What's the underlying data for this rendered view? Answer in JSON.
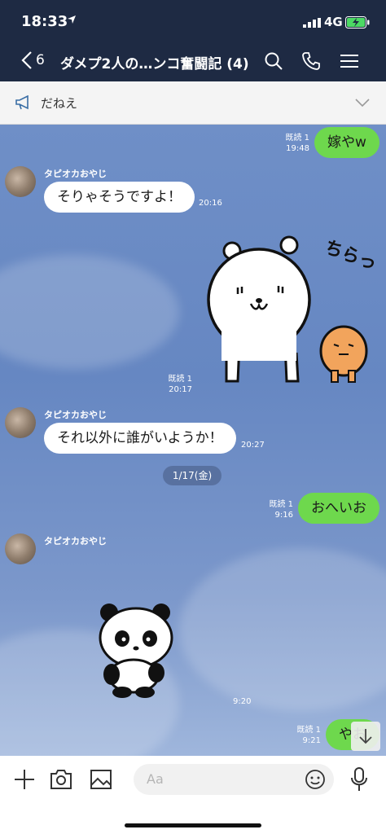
{
  "status": {
    "time": "18:33",
    "network": "4G"
  },
  "nav": {
    "back_count": "6",
    "title": "ダメプ2人の…ンコ奮闘記 (4)"
  },
  "announcement": {
    "text": "だねえ"
  },
  "chat": {
    "date_separator": "1/17(金)",
    "sender_name": "タピオカおやじ",
    "messages": [
      {
        "text": "嫁やw",
        "read": "既読 1",
        "time": "19:48"
      },
      {
        "text": "そりゃそうですよ！",
        "time": "20:16"
      },
      {
        "read": "既読 1",
        "time": "20:17",
        "sticker": "polar-bear-sticker",
        "sticker_text": "ちらっ"
      },
      {
        "text": "それ以外に誰がいようか！",
        "time": "20:27"
      },
      {
        "text": "おへいお",
        "read": "既読 1",
        "time": "9:16"
      },
      {
        "time": "9:20",
        "sticker": "panda-sticker"
      },
      {
        "text": "やお",
        "read": "既読 1",
        "time": "9:21"
      }
    ]
  },
  "input": {
    "placeholder": "Aa"
  },
  "colors": {
    "header_bg": "#1e2a43",
    "outgoing_bubble": "#6ed84d",
    "incoming_bubble": "#ffffff",
    "chat_bg": "#6f8fc7"
  }
}
